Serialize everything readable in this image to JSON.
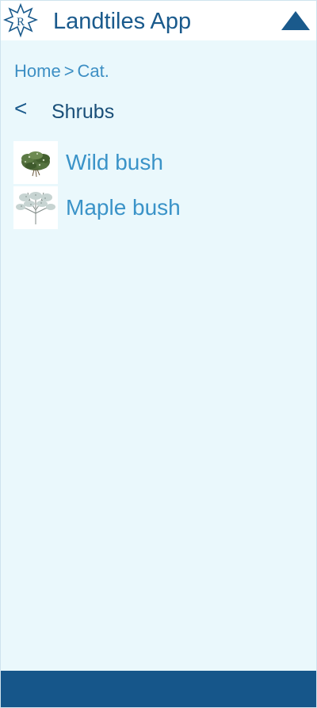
{
  "header": {
    "title": "Landtiles App",
    "logo_icon": "star-r-logo-icon",
    "menu_icon": "triangle-up-icon"
  },
  "breadcrumb": {
    "home": "Home",
    "separator": ">",
    "category": "Cat."
  },
  "category": {
    "back_label": "<",
    "title": "Shrubs"
  },
  "items": [
    {
      "label": "Wild bush",
      "icon": "wild-bush-thumbnail"
    },
    {
      "label": "Maple bush",
      "icon": "maple-bush-thumbnail"
    }
  ],
  "colors": {
    "brand": "#16568a",
    "link": "#3a93c8",
    "background": "#eaf8fc"
  }
}
